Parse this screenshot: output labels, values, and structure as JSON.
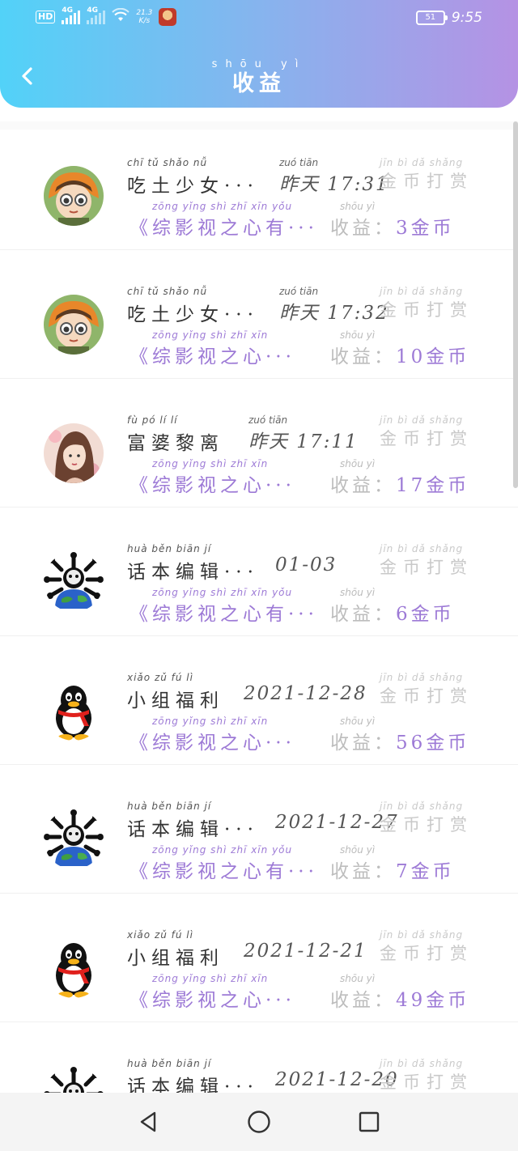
{
  "status_bar": {
    "hd": "HD",
    "net1": "4G",
    "net2": "4G",
    "speed_value": "21.3",
    "speed_unit": "K/s",
    "battery": "51",
    "time": "9:55"
  },
  "header": {
    "title": "收益",
    "title_pinyin": "shōu yì",
    "back_icon": "back-arrow-icon"
  },
  "items": [
    {
      "avatar": "girl-glasses",
      "name_pinyin": "chī tǔ shǎo nǚ",
      "name": "吃土少女···",
      "time_pinyin": "zuó tiān",
      "time": "昨天 17:31",
      "reward_pinyin": "jīn bì dǎ shǎng",
      "reward": "金币打赏",
      "video_pinyin": "zōng yǐng shì zhī xīn yǒu",
      "video": "《综影视之心有···",
      "income_pinyin": "shōu yì",
      "income_label": "收益：",
      "amount": "3",
      "unit_pinyin": "jīn bì",
      "unit": "金币"
    },
    {
      "avatar": "girl-glasses",
      "name_pinyin": "chī tǔ shǎo nǚ",
      "name": "吃土少女···",
      "time_pinyin": "zuó tiān",
      "time": "昨天 17:32",
      "reward_pinyin": "jīn bì dǎ shǎng",
      "reward": "金币打赏",
      "video_pinyin": "zōng yǐng shì zhī xīn",
      "video": "《综影视之心···",
      "income_pinyin": "shōu yì",
      "income_label": "收益：",
      "amount": "10",
      "unit_pinyin": "jīn bì",
      "unit": "金币"
    },
    {
      "avatar": "woman-portrait",
      "name_pinyin": "fù pó lí lí",
      "name": "富婆黎离",
      "time_pinyin": "zuó tiān",
      "time": "昨天 17:11",
      "reward_pinyin": "jīn bì dǎ shǎng",
      "reward": "金币打赏",
      "video_pinyin": "zōng yǐng shì zhī xīn",
      "video": "《综影视之心···",
      "income_pinyin": "shōu yì",
      "income_label": "收益：",
      "amount": "17",
      "unit_pinyin": "jīn bì",
      "unit": "金币"
    },
    {
      "avatar": "earth-skull",
      "name_pinyin": "huà běn biān jí",
      "name": "话本编辑···",
      "time_pinyin": "",
      "time": "01-03",
      "reward_pinyin": "jīn bì dǎ shǎng",
      "reward": "金币打赏",
      "video_pinyin": "zōng yǐng shì zhī xīn yǒu",
      "video": "《综影视之心有···",
      "income_pinyin": "shōu yì",
      "income_label": "收益：",
      "amount": "6",
      "unit_pinyin": "jīn bì",
      "unit": "金币"
    },
    {
      "avatar": "qq-penguin",
      "name_pinyin": "xiǎo zǔ fú lì",
      "name": "小组福利",
      "time_pinyin": "",
      "time": "2021-12-28",
      "reward_pinyin": "jīn bì dǎ shǎng",
      "reward": "金币打赏",
      "video_pinyin": "zōng yǐng shì zhī xīn",
      "video": "《综影视之心···",
      "income_pinyin": "shōu yì",
      "income_label": "收益：",
      "amount": "56",
      "unit_pinyin": "jīn bì",
      "unit": "金币"
    },
    {
      "avatar": "earth-skull",
      "name_pinyin": "huà běn biān jí",
      "name": "话本编辑···",
      "time_pinyin": "",
      "time": "2021-12-27",
      "reward_pinyin": "jīn bì dǎ shǎng",
      "reward": "金币打赏",
      "video_pinyin": "zōng yǐng shì zhī xīn yǒu",
      "video": "《综影视之心有···",
      "income_pinyin": "shōu yì",
      "income_label": "收益：",
      "amount": "7",
      "unit_pinyin": "jīn bì",
      "unit": "金币"
    },
    {
      "avatar": "qq-penguin",
      "name_pinyin": "xiǎo zǔ fú lì",
      "name": "小组福利",
      "time_pinyin": "",
      "time": "2021-12-21",
      "reward_pinyin": "jīn bì dǎ shǎng",
      "reward": "金币打赏",
      "video_pinyin": "zōng yǐng shì zhī xīn",
      "video": "《综影视之心···",
      "income_pinyin": "shōu yì",
      "income_label": "收益：",
      "amount": "49",
      "unit_pinyin": "jīn bì",
      "unit": "金币"
    },
    {
      "avatar": "earth-skull",
      "name_pinyin": "huà běn biān jí",
      "name": "话本编辑···",
      "time_pinyin": "",
      "time": "2021-12-20",
      "reward_pinyin": "jīn bì dǎ shǎng",
      "reward": "金币打赏",
      "video_pinyin": "",
      "video": "",
      "income_pinyin": "",
      "income_label": "",
      "amount": "",
      "unit_pinyin": "",
      "unit": ""
    }
  ],
  "nav": {
    "back": "nav-back-triangle-icon",
    "home": "nav-home-circle-icon",
    "recent": "nav-recent-square-icon"
  },
  "colors": {
    "header_start": "#52d2f8",
    "header_end": "#b592e4",
    "accent_purple": "#9d7ad6",
    "reward_gray": "#c9c9c9"
  }
}
